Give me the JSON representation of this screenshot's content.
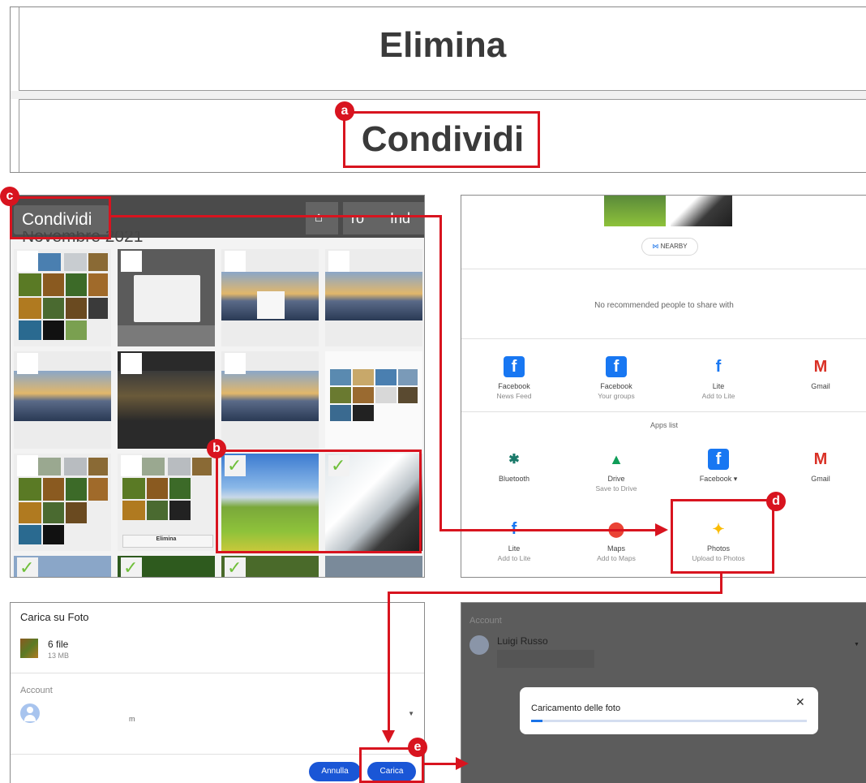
{
  "menu": {
    "delete_label": "Elimina",
    "share_label": "Condividi"
  },
  "callouts": {
    "a": "a",
    "b": "b",
    "c": "c",
    "d": "d",
    "e": "e"
  },
  "gallery": {
    "share_button": "Condividi",
    "toolbar_text_1": "ro",
    "toolbar_text_2": "Ind",
    "month_header": "Novembre 2021",
    "mini_caption": "Elimina"
  },
  "share_sheet": {
    "nearby_label": "NEARBY",
    "no_people_text": "No recommended people to share with",
    "apps_list_title": "Apps list",
    "top_apps": [
      {
        "name": "Facebook",
        "sub": "News Feed",
        "icon": "facebook-icon"
      },
      {
        "name": "Facebook",
        "sub": "Your groups",
        "icon": "facebook-icon"
      },
      {
        "name": "Lite",
        "sub": "Add to Lite",
        "icon": "facebook-lite-icon"
      },
      {
        "name": "Gmail",
        "sub": "",
        "icon": "gmail-icon"
      }
    ],
    "apps": [
      {
        "name": "Bluetooth",
        "sub": "",
        "icon": "bluetooth-icon"
      },
      {
        "name": "Drive",
        "sub": "Save to Drive",
        "icon": "drive-icon"
      },
      {
        "name": "Facebook ▾",
        "sub": "",
        "icon": "facebook-icon"
      },
      {
        "name": "Gmail",
        "sub": "",
        "icon": "gmail-icon"
      },
      {
        "name": "Lite",
        "sub": "Add to Lite",
        "icon": "facebook-lite-icon"
      },
      {
        "name": "Maps",
        "sub": "Add to Maps",
        "icon": "maps-icon"
      },
      {
        "name": "Photos",
        "sub": "Upload to Photos",
        "icon": "photos-icon"
      }
    ]
  },
  "upload_dialog": {
    "title": "Carica su Foto",
    "file_count": "6 file",
    "file_size": "13 MB",
    "account_label": "Account",
    "account_partial": "m",
    "cancel_label": "Annulla",
    "upload_label": "Carica"
  },
  "progress_screen": {
    "account_label": "Account",
    "account_name": "Luigi Russo",
    "dialog_title": "Caricamento delle foto",
    "progress_fraction": 0.04
  },
  "colors": {
    "callout_red": "#d8141f",
    "accent_blue": "#1a56d6",
    "progress_blue": "#1a73e8"
  }
}
